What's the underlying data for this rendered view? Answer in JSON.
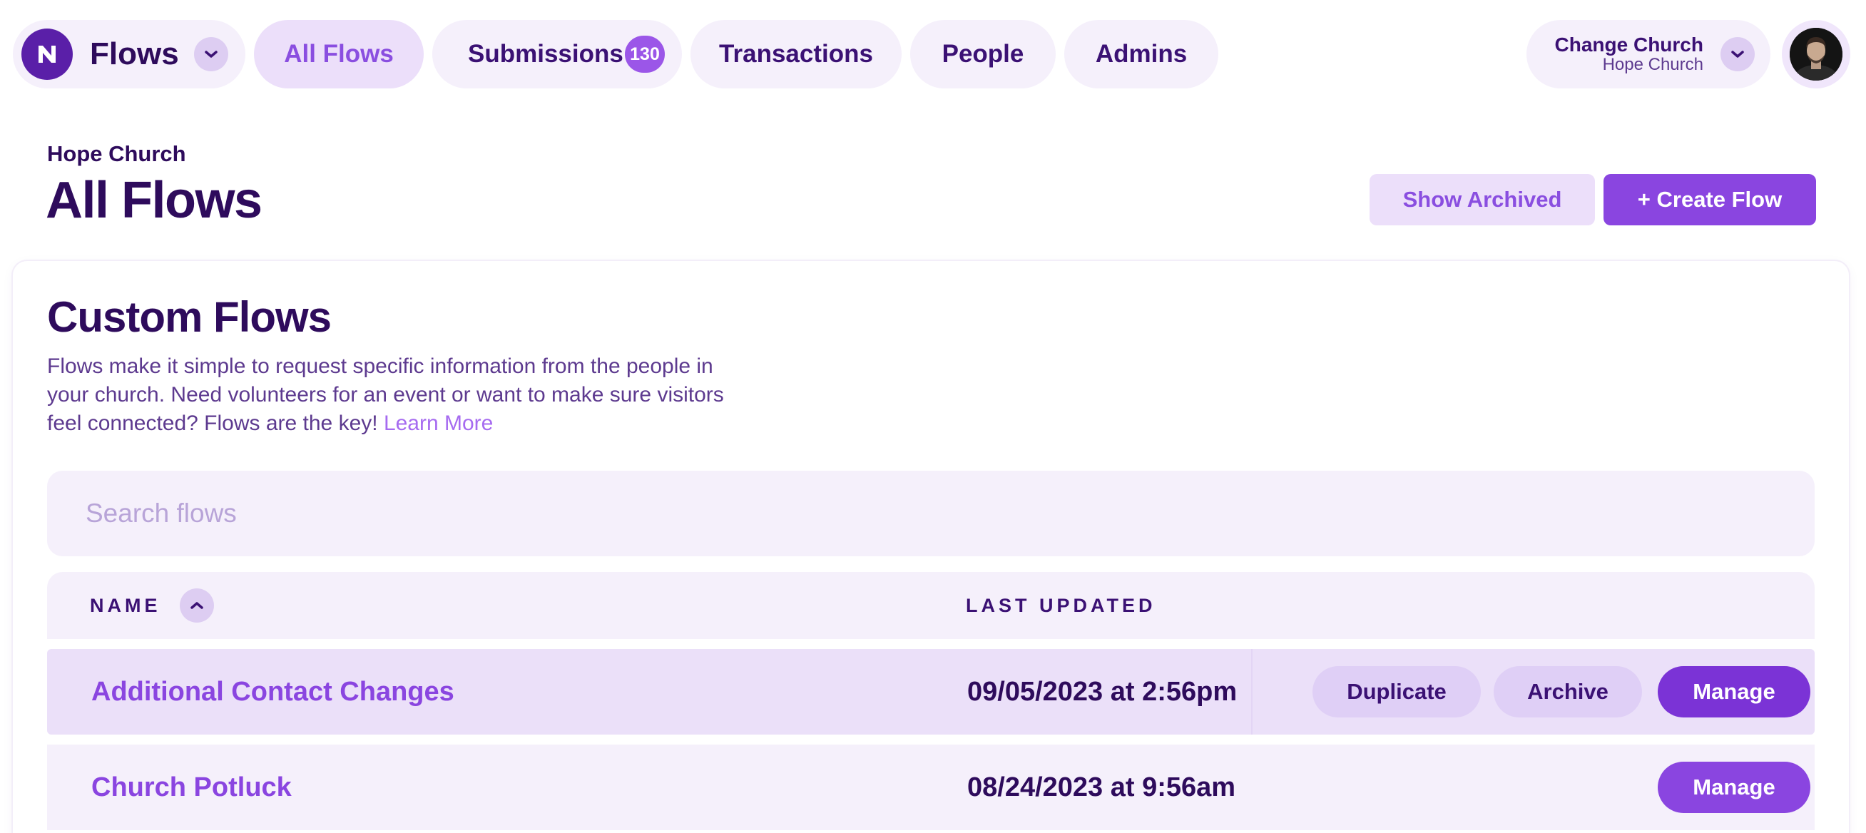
{
  "nav": {
    "brand_title": "Flows",
    "tabs": [
      {
        "label": "All Flows",
        "active": true
      },
      {
        "label": "Submissions",
        "badge": "130"
      },
      {
        "label": "Transactions"
      },
      {
        "label": "People"
      },
      {
        "label": "Admins"
      }
    ],
    "church_switch": {
      "label": "Change Church",
      "current": "Hope Church"
    }
  },
  "header": {
    "org_name": "Hope Church",
    "title": "All Flows",
    "show_archived_label": "Show Archived",
    "create_flow_label": "+ Create Flow"
  },
  "card": {
    "title": "Custom Flows",
    "description": "Flows make it simple to request specific information from the people in your church. Need volunteers for an event or want to make sure visitors feel connected? Flows are the key!",
    "learn_more": "Learn More",
    "search_placeholder": "Search flows"
  },
  "table": {
    "columns": {
      "name": "NAME",
      "last_updated": "LAST UPDATED"
    },
    "rows": [
      {
        "name": "Additional Contact Changes",
        "last_updated": "09/05/2023 at 2:56pm",
        "actions": {
          "duplicate": "Duplicate",
          "archive": "Archive",
          "manage": "Manage"
        }
      },
      {
        "name": "Church Potluck",
        "last_updated": "08/24/2023 at 9:56am",
        "actions": {
          "manage": "Manage"
        }
      }
    ]
  },
  "colors": {
    "primary": "#8a45e0",
    "dark_text": "#2e0b5c",
    "light_bg": "#f5f0fb",
    "badge": "#9b56e8"
  },
  "icons": {
    "logo": "flows-logo-icon",
    "dropdown": "chevron-down-icon",
    "sort": "chevron-up-icon"
  }
}
